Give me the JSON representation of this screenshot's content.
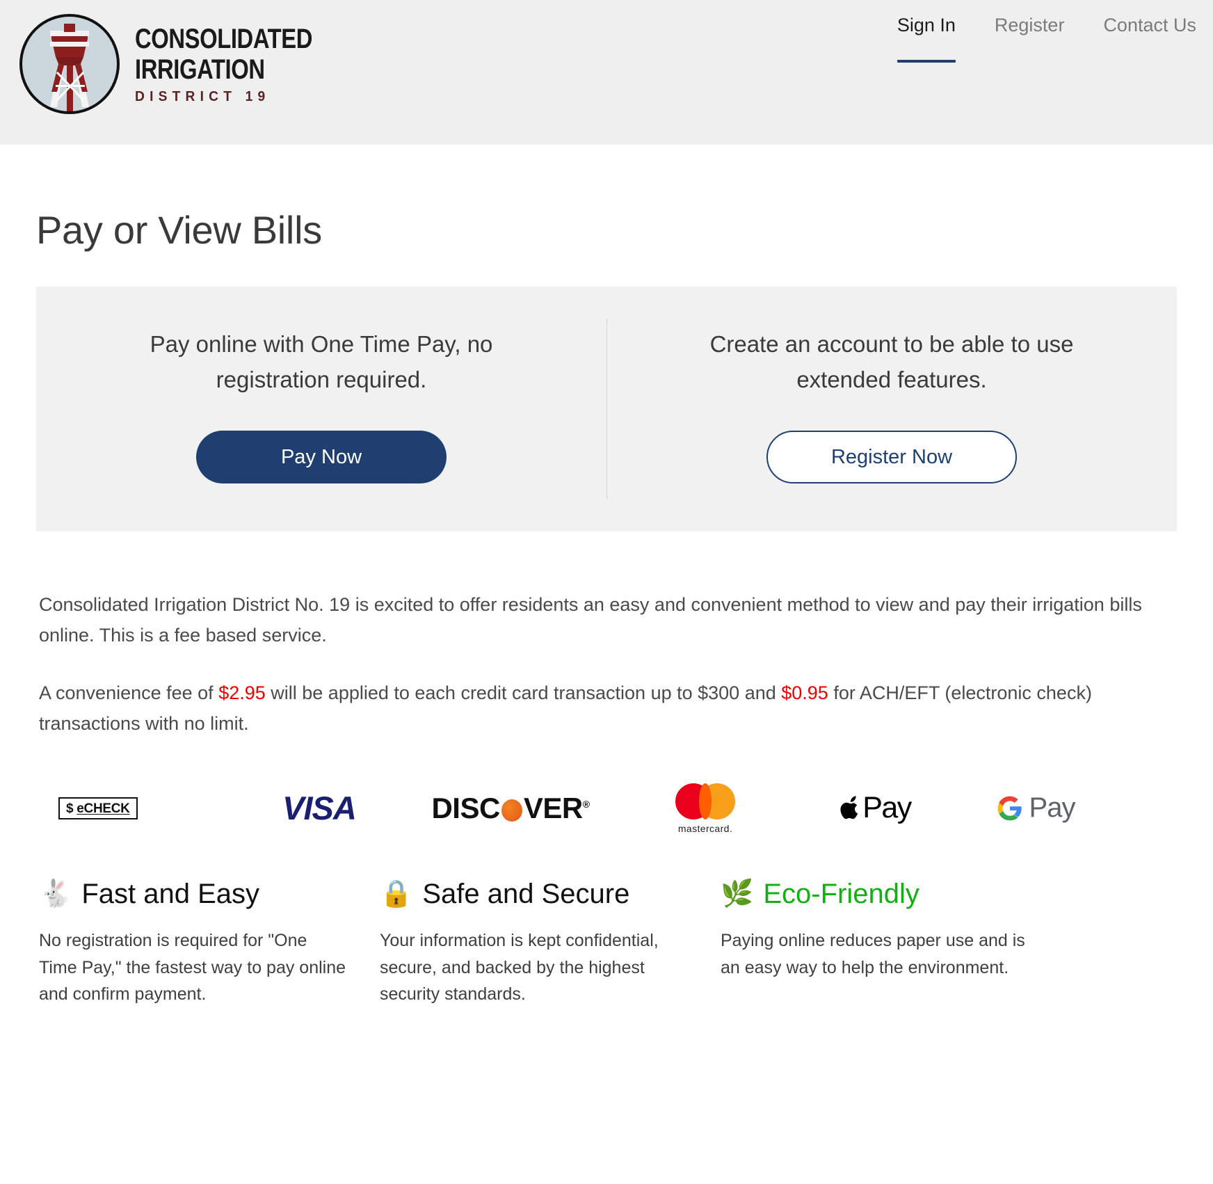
{
  "header": {
    "logo": {
      "icon": "water-tower-logo",
      "line1": "CONSOLIDATED",
      "line2": "IRRIGATION",
      "line3": "DISTRICT 19"
    },
    "nav": [
      {
        "label": "Sign In",
        "active": true
      },
      {
        "label": "Register",
        "active": false
      },
      {
        "label": "Contact Us",
        "active": false
      }
    ]
  },
  "main": {
    "title": "Pay or View Bills",
    "cta": {
      "left": {
        "heading": "Pay online with One Time Pay, no registration required.",
        "button": "Pay Now"
      },
      "right": {
        "heading": "Create an account to be able to use extended features.",
        "button": "Register Now"
      }
    },
    "intro": "Consolidated Irrigation District No. 19 is excited to offer residents an easy and convenient method to view and pay their irrigation bills online. This is a fee based service.",
    "fee_notice": {
      "part1": "A convenience fee of ",
      "fee_cc": "$2.95",
      "part2": " will be applied to each credit card transaction up to $300 and ",
      "fee_ach": "$0.95",
      "part3": " for ACH/EFT (electronic check) transactions with no limit."
    },
    "payment_methods": [
      {
        "name": "eCheck",
        "icon": "echeck-icon",
        "dollar": "$",
        "word": "eCHECK"
      },
      {
        "name": "Visa",
        "icon": "visa-icon",
        "word": "VISA"
      },
      {
        "name": "Discover",
        "icon": "discover-icon",
        "word": "DISC",
        "word2": "VER",
        "mark": "®"
      },
      {
        "name": "Mastercard",
        "icon": "mastercard-icon",
        "word": "mastercard."
      },
      {
        "name": "Apple Pay",
        "icon": "apple-pay-icon",
        "word": "Pay"
      },
      {
        "name": "Google Pay",
        "icon": "google-pay-icon",
        "word": "Pay"
      }
    ],
    "features": [
      {
        "emoji": "🐇",
        "icon": "rabbit-icon",
        "title": "Fast and Easy",
        "body": "No registration is required for \"One Time Pay,\" the fastest way to pay online and confirm payment."
      },
      {
        "emoji": "🔒",
        "icon": "lock-icon",
        "title": "Safe and Secure",
        "body": "Your information is kept confidential, secure, and backed by the highest security standards."
      },
      {
        "emoji": "🌿",
        "icon": "leaf-icon",
        "title": "Eco-Friendly",
        "body": "Paying online reduces paper use and is an easy way to help the environment."
      }
    ]
  },
  "colors": {
    "brand_blue": "#1e3f6f",
    "fee_red": "#ee0000",
    "eco_green": "#12b112",
    "header_bg": "#efefef",
    "panel_bg": "#f1f1f1"
  }
}
